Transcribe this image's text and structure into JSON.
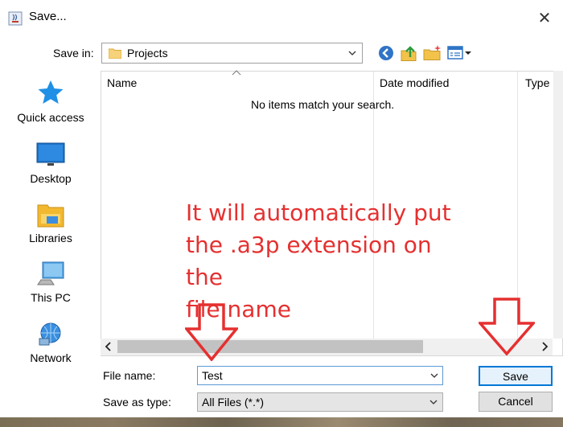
{
  "window": {
    "title": "Save...",
    "close_glyph": "✕",
    "icon": "java-cup-icon"
  },
  "toolbar": {
    "save_in_label": "Save in:",
    "save_in_value": "Projects",
    "buttons": [
      "back-icon",
      "up-folder-icon",
      "new-folder-icon",
      "view-menu-icon"
    ]
  },
  "sidebar": {
    "items": [
      {
        "label": "Quick access",
        "icon": "star-icon"
      },
      {
        "label": "Desktop",
        "icon": "desktop-icon"
      },
      {
        "label": "Libraries",
        "icon": "libraries-icon"
      },
      {
        "label": "This PC",
        "icon": "computer-icon"
      },
      {
        "label": "Network",
        "icon": "network-icon"
      }
    ]
  },
  "filelist": {
    "columns": [
      "Name",
      "Date modified",
      "Type"
    ],
    "empty_message": "No items match your search."
  },
  "form": {
    "file_name_label": "File name:",
    "file_name_value": "Test",
    "save_as_type_label": "Save as type:",
    "save_as_type_value": "All Files (*.*)",
    "save_label": "Save",
    "cancel_label": "Cancel"
  },
  "annotation": {
    "lines": [
      "It will automatically put",
      "the .a3p extension on the",
      "file name"
    ],
    "color": "#e53030"
  },
  "colors": {
    "accent": "#0078d7",
    "annotation": "#e53030"
  }
}
